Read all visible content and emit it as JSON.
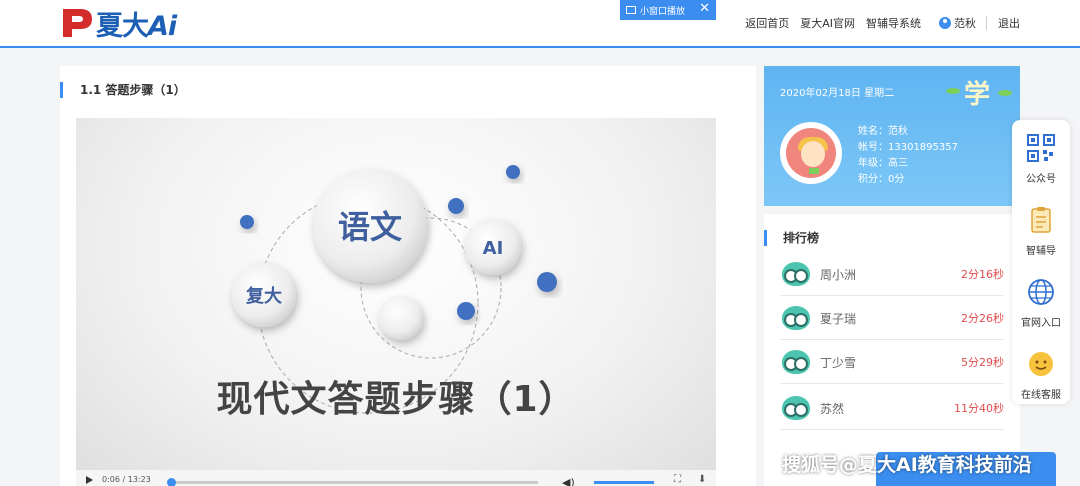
{
  "header": {
    "logo_text": "夏大",
    "logo_ai": "Ai",
    "mini_window_label": "小窗口播放",
    "mini_window_close": "✕",
    "nav": [
      "返回首页",
      "夏大AI官网",
      "智辅导系统"
    ],
    "username": "范秋",
    "logout": "退出"
  },
  "main": {
    "lesson_title": "1.1 答题步骤（1）",
    "video": {
      "bubbles": {
        "center": "语文",
        "left": "复大",
        "right": "AI"
      },
      "heading": "现代文答题步骤（1）",
      "time": "0:06 / 13:23",
      "progress": 0.008
    }
  },
  "profile": {
    "date": "2020年02月18日 星期二",
    "badge": "学",
    "name_label": "姓名：范秋",
    "account_label": "帐号：13301895357",
    "grade_label": "年级：高三",
    "points_label": "积分：0分"
  },
  "ranking": {
    "title": "排行榜",
    "rows": [
      {
        "name": "周小洲",
        "time": "2分16秒"
      },
      {
        "name": "夏子瑞",
        "time": "2分26秒"
      },
      {
        "name": "丁少雪",
        "time": "5分29秒"
      },
      {
        "name": "苏然",
        "time": "11分40秒"
      }
    ]
  },
  "sidebar": {
    "items": [
      {
        "label": "公众号",
        "icon": "qr-code-icon"
      },
      {
        "label": "智辅导",
        "icon": "clipboard-icon"
      },
      {
        "label": "官网入口",
        "icon": "globe-icon"
      },
      {
        "label": "在线客服",
        "icon": "smiley-icon"
      }
    ]
  },
  "watermark": "搜狐号@夏大AI教育科技前沿",
  "colors": {
    "accent": "#3b8ef0",
    "brand": "#1d5fb5",
    "logo_red": "#d42b2b",
    "time_red": "#e24c4c"
  }
}
